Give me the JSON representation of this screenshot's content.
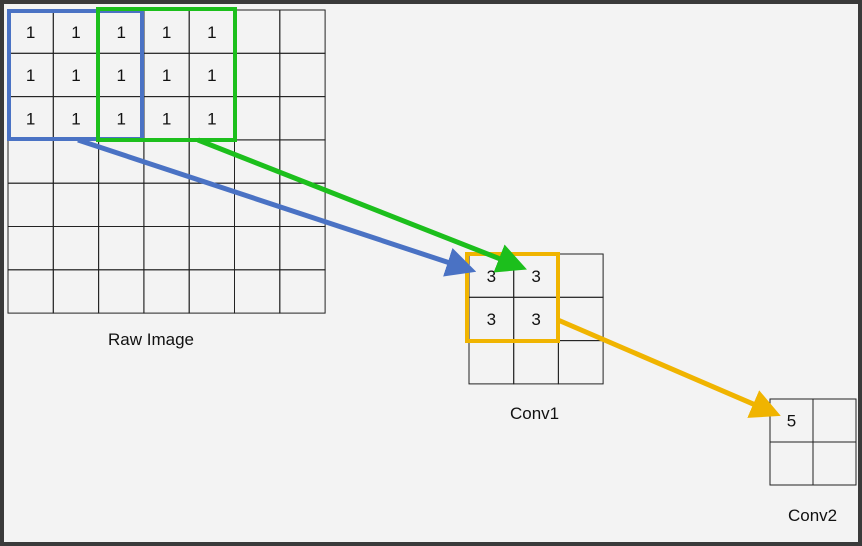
{
  "raw_image": {
    "label": "Raw Image",
    "values": [
      [
        "1",
        "1",
        "1",
        "1",
        "1",
        "",
        ""
      ],
      [
        "1",
        "1",
        "1",
        "1",
        "1",
        "",
        ""
      ],
      [
        "1",
        "1",
        "1",
        "1",
        "1",
        "",
        ""
      ],
      [
        "",
        "",
        "",
        "",
        "",
        "",
        ""
      ],
      [
        "",
        "",
        "",
        "",
        "",
        "",
        ""
      ],
      [
        "",
        "",
        "",
        "",
        "",
        "",
        ""
      ],
      [
        "",
        "",
        "",
        "",
        "",
        "",
        ""
      ]
    ]
  },
  "conv1": {
    "label": "Conv1",
    "values": [
      [
        "3",
        "3",
        ""
      ],
      [
        "3",
        "3",
        ""
      ],
      [
        "",
        "",
        ""
      ]
    ]
  },
  "conv2": {
    "label": "Conv2",
    "values": [
      [
        "5",
        ""
      ],
      [
        "",
        ""
      ]
    ]
  },
  "colors": {
    "blue": "#4a72c4",
    "green": "#1cbf1c",
    "gold": "#f0b400",
    "grid": "#222222",
    "background": "#f3f3f3",
    "frame": "#3a3a3a"
  }
}
